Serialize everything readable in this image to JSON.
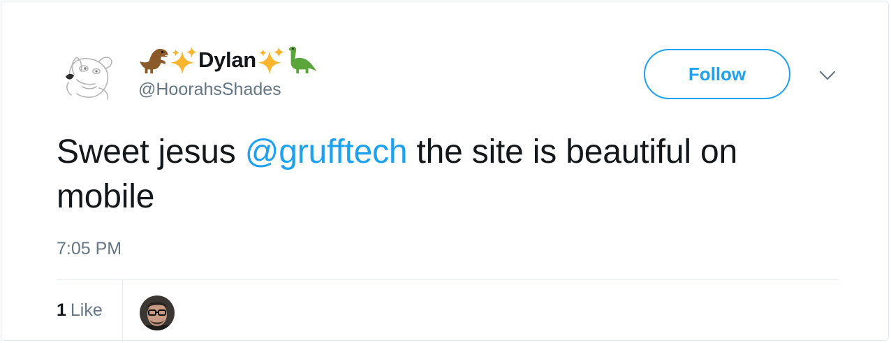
{
  "author": {
    "display_name": "Dylan",
    "handle": "@HoorahsShades",
    "emoji_left": [
      "t-rex-icon",
      "sparkles-icon"
    ],
    "emoji_right": [
      "sparkles-icon",
      "sauropod-icon"
    ]
  },
  "follow_button": {
    "label": "Follow"
  },
  "tweet": {
    "text_before": "Sweet jesus ",
    "mention": "@grufftech",
    "text_after": " the site is beautiful on mobile",
    "timestamp": "7:05 PM"
  },
  "likes": {
    "count": "1",
    "label": "Like"
  },
  "colors": {
    "accent": "#1da1f2",
    "text_primary": "#14171a",
    "text_secondary": "#657786",
    "border": "#e1e8ed"
  }
}
